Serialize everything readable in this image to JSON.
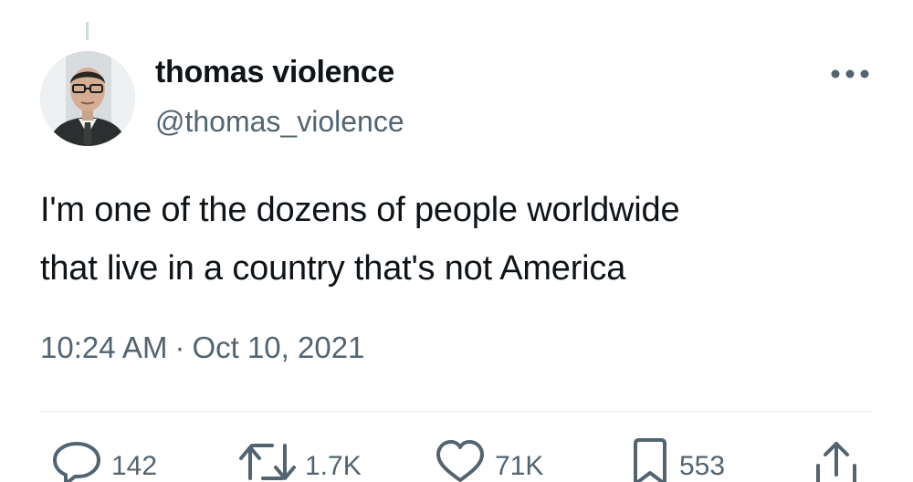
{
  "tweet": {
    "display_name": "thomas violence",
    "handle": "@thomas_violence",
    "text_line1": "I'm one of the dozens of people worldwide",
    "text_line2": "that live in a country that's not America",
    "time": "10:24 AM",
    "separator": "·",
    "date": "Oct 10, 2021"
  },
  "actions": {
    "reply_count": "142",
    "retweet_count": "1.7K",
    "like_count": "71K",
    "bookmark_count": "553"
  },
  "icons": {
    "more": "more-horizontal-icon",
    "reply": "reply-icon",
    "retweet": "retweet-icon",
    "like": "heart-icon",
    "bookmark": "bookmark-icon",
    "share": "share-icon"
  },
  "colors": {
    "text": "#0f1419",
    "secondary": "#536471",
    "divider": "#e6ecf0"
  }
}
